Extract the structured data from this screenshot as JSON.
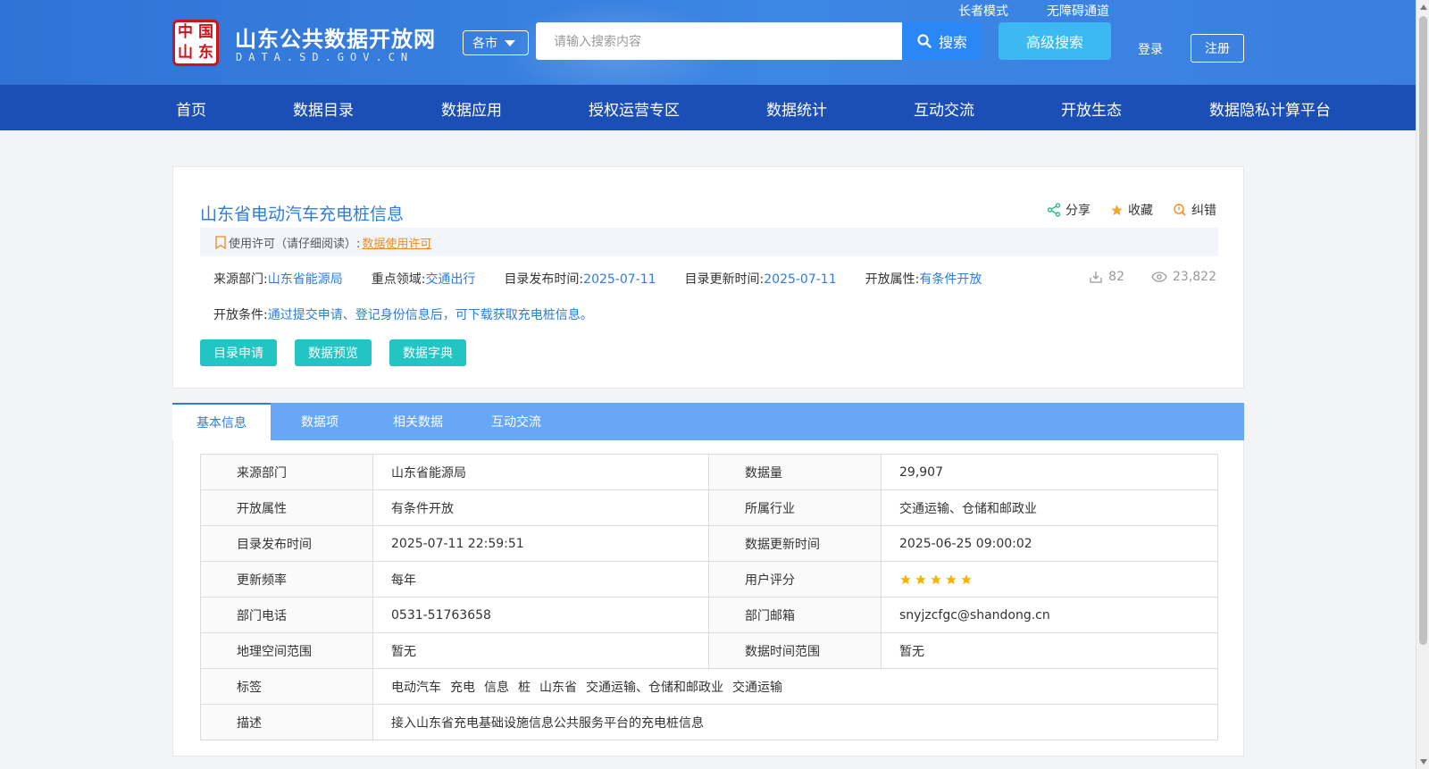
{
  "header": {
    "logo_seal_chars": [
      "中",
      "国",
      "山",
      "东"
    ],
    "site_title": "山东公共数据开放网",
    "site_domain": "DATA.SD.GOV.CN",
    "city_select": "各市",
    "search_placeholder": "请输入搜索内容",
    "search_button": "搜索",
    "advanced_search": "高级搜索",
    "elder_mode": "长者模式",
    "accessibility": "无障碍通道",
    "login": "登录",
    "register": "注册"
  },
  "nav": [
    "首页",
    "数据目录",
    "数据应用",
    "授权运营专区",
    "数据统计",
    "互动交流",
    "开放生态",
    "数据隐私计算平台"
  ],
  "dataset": {
    "title": "山东省电动汽车充电桩信息",
    "actions": {
      "share": "分享",
      "favorite": "收藏",
      "report": "纠错"
    },
    "license_label": "使用许可（请仔细阅读）:",
    "license_link": "数据使用许可",
    "meta": {
      "source_label": "来源部门:",
      "source": "山东省能源局",
      "domain_label": "重点领域:",
      "domain": "交通出行",
      "publish_label": "目录发布时间:",
      "publish": "2025-07-11",
      "update_label": "目录更新时间:",
      "update": "2025-07-11",
      "open_label": "开放属性:",
      "open": "有条件开放"
    },
    "downloads": "82",
    "views": "23,822",
    "condition_label": "开放条件:",
    "condition": "通过提交申请、登记身份信息后，可下载获取充电桩信息。",
    "buttons": [
      "目录申请",
      "数据预览",
      "数据字典"
    ]
  },
  "tabs": [
    "基本信息",
    "数据项",
    "相关数据",
    "互动交流"
  ],
  "info_table": {
    "rows": [
      [
        "来源部门",
        "山东省能源局",
        "数据量",
        "29,907"
      ],
      [
        "开放属性",
        "有条件开放",
        "所属行业",
        "交通运输、仓储和邮政业"
      ],
      [
        "目录发布时间",
        "2025-07-11 22:59:51",
        "数据更新时间",
        "2025-06-25 09:00:02"
      ],
      [
        "更新频率",
        "每年",
        "用户评分",
        ""
      ],
      [
        "部门电话",
        "0531-51763658",
        "部门邮箱",
        "snyjzcfgc@shandong.cn"
      ],
      [
        "地理空间范围",
        "暂无",
        "数据时间范围",
        "暂无"
      ]
    ],
    "tags_label": "标签",
    "tags": [
      "电动汽车",
      "充电",
      "信息",
      "桩",
      "山东省",
      "交通运输、仓储和邮政业",
      "交通运输"
    ],
    "desc_label": "描述",
    "desc": "接入山东省充电基础设施信息公共服务平台的充电桩信息",
    "rating_stars": 5
  },
  "colors": {
    "nav_bg": "#1c4fb6",
    "link_blue": "#2b7de0",
    "teal_button": "#23c4c4",
    "tab_bar": "#67a7f6",
    "star": "#f5b400",
    "license_orange": "#f08c1e"
  }
}
